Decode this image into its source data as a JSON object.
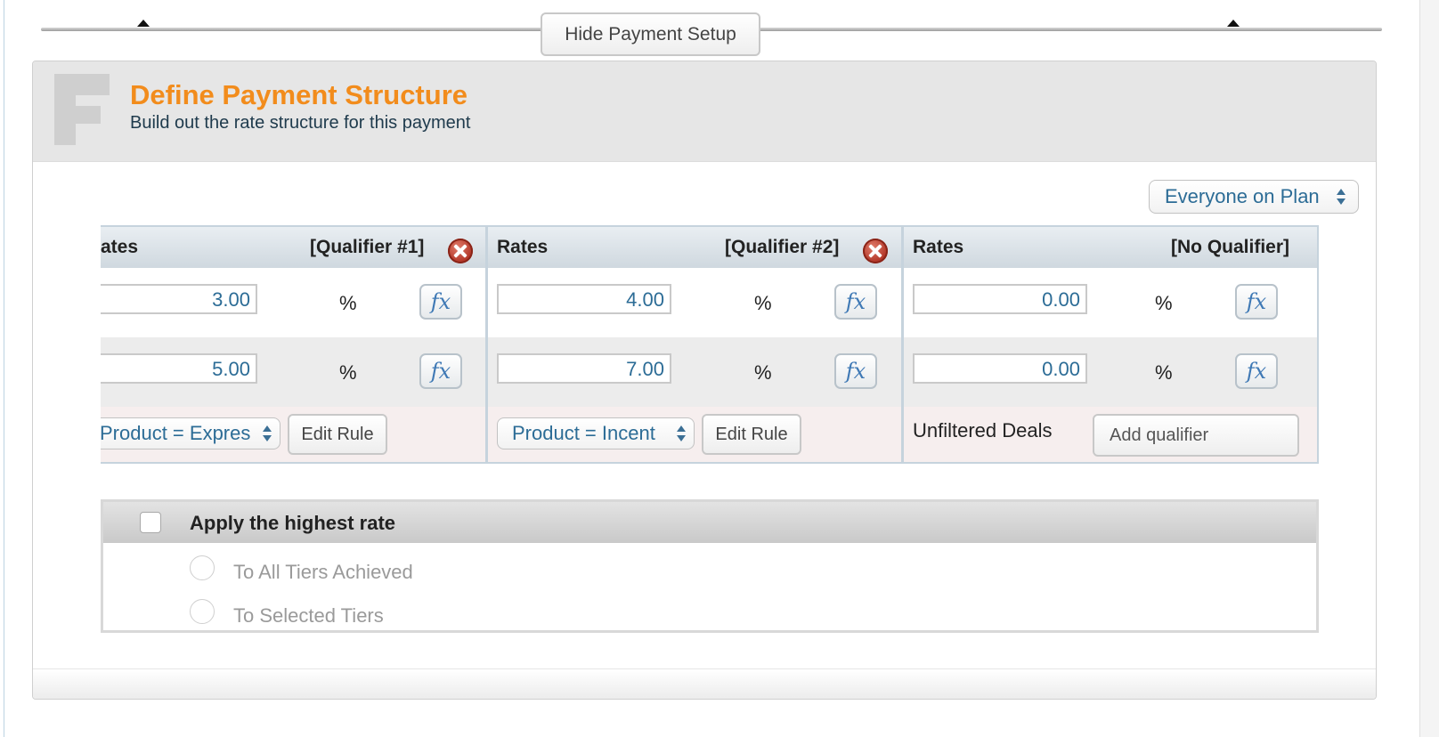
{
  "toggle": {
    "hide_setup_label": "Hide Payment Setup"
  },
  "section": {
    "title": "Define Payment Structure",
    "subtitle": "Build out the rate structure for this payment"
  },
  "scope_select": {
    "value": "Everyone on Plan"
  },
  "columns": [
    {
      "header_left": "ates",
      "header_right": "[Qualifier #1]",
      "rates": [
        "3.00",
        "5.00"
      ],
      "unit": "%",
      "fx_label": "fx",
      "filter_value": "Product = Expres",
      "edit_label": "Edit Rule"
    },
    {
      "header_left": "Rates",
      "header_right": "[Qualifier #2]",
      "rates": [
        "4.00",
        "7.00"
      ],
      "unit": "%",
      "fx_label": "fx",
      "filter_value": "Product = Incent",
      "edit_label": "Edit Rule"
    },
    {
      "header_left": "Rates",
      "header_right": "[No Qualifier]",
      "rates": [
        "0.00",
        "0.00"
      ],
      "unit": "%",
      "fx_label": "fx",
      "unfiltered_label": "Unfiltered Deals",
      "add_qualifier_label": "Add qualifier"
    }
  ],
  "highest_rate": {
    "label": "Apply the highest rate",
    "checked": false,
    "options": [
      "To All Tiers Achieved",
      "To Selected Tiers"
    ]
  },
  "colors": {
    "title": "#f28c1c",
    "link_blue": "#2c6c96",
    "delete_red": "#b03325"
  },
  "icons": [
    "caret-up-icon",
    "delete-icon",
    "fx-icon",
    "updown-chevron-icon"
  ]
}
